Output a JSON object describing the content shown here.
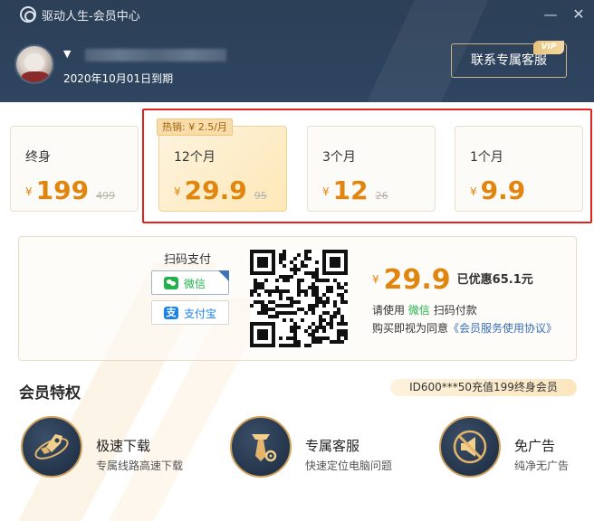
{
  "window": {
    "title": "驱动人生-会员中心",
    "minimize_glyph": "—",
    "close_glyph": "✕"
  },
  "user": {
    "dropdown_glyph": "▼",
    "expire_text": "2020年10月01日到期"
  },
  "header": {
    "contact_label": "联系专属客服",
    "vip_badge": "VIP"
  },
  "plans": {
    "hot_tag": "热销: ¥ 2.5/月",
    "currency": "¥",
    "items": [
      {
        "name": "终身",
        "price": "199",
        "original": "499"
      },
      {
        "name": "12个月",
        "price": "29.9",
        "original": "95"
      },
      {
        "name": "3个月",
        "price": "12",
        "original": "26"
      },
      {
        "name": "1个月",
        "price": "9.9",
        "original": ""
      }
    ],
    "selected_index": 1
  },
  "payment": {
    "scan_label": "扫码支付",
    "wechat_label": "微信",
    "alipay_label": "支付宝",
    "alipay_glyph": "支",
    "currency": "¥",
    "price": "29.9",
    "saved": "已优惠65.1元",
    "hint_prefix": "请使用",
    "hint_app": "微信",
    "hint_suffix": "扫码付款",
    "agree_prefix": "购买即视为同意",
    "agree_link": "《会员服务使用协议》"
  },
  "privileges": {
    "title": "会员特权",
    "marquee": "ID600***50充值199终身会员",
    "items": [
      {
        "title": "极速下载",
        "desc": "专属线路高速下载",
        "icon": "rocket-icon"
      },
      {
        "title": "专属客服",
        "desc": "快速定位电脑问题",
        "icon": "service-tie-icon"
      },
      {
        "title": "免广告",
        "desc": "纯净无广告",
        "icon": "no-ads-icon"
      }
    ]
  },
  "colors": {
    "header_bg": "#2f4560",
    "accent_orange": "#e0860f",
    "highlight_red": "#e2251c",
    "wechat_green": "#22b14c",
    "alipay_blue": "#1a84e8"
  }
}
